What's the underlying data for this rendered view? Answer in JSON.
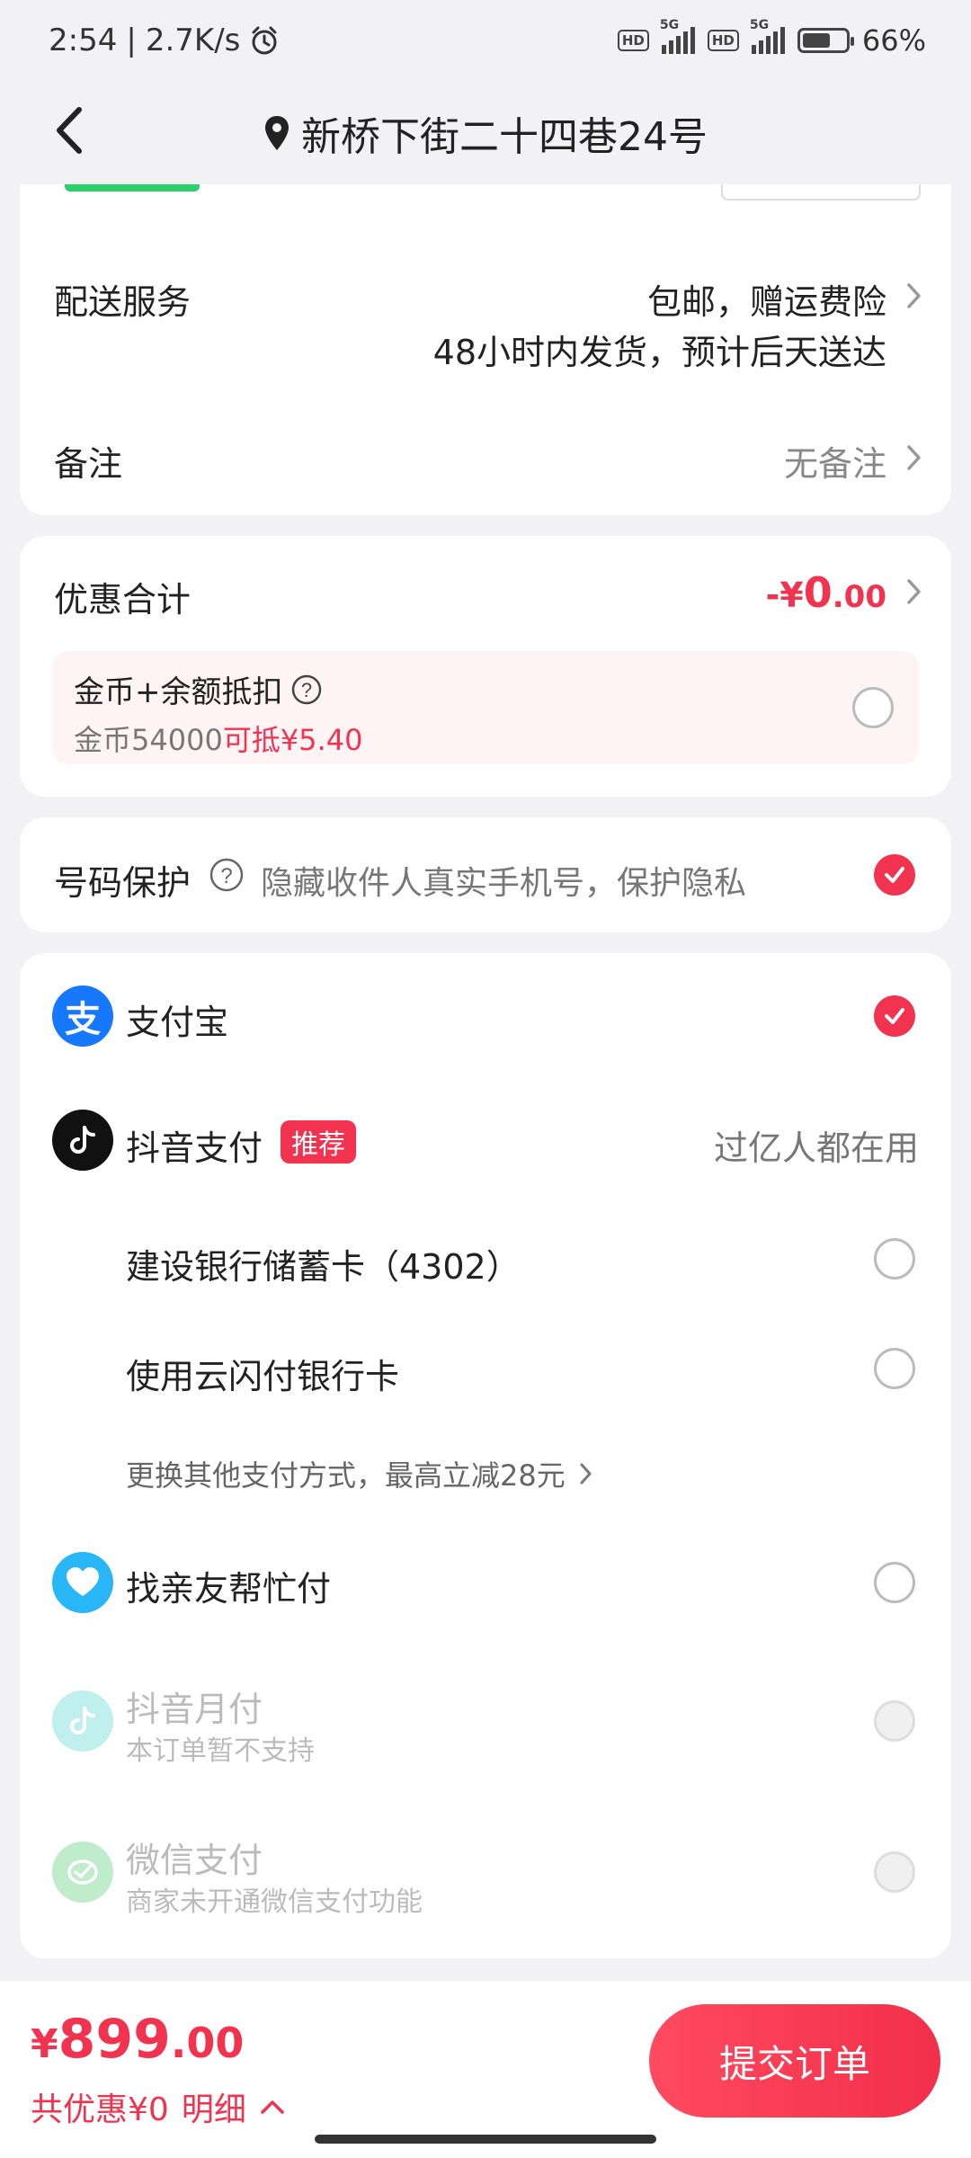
{
  "status_bar": {
    "time": "2:54",
    "net_speed": "2.7K/s",
    "battery": "66%",
    "battery_level": 0.66
  },
  "header": {
    "title": "新桥下街二十四巷24号"
  },
  "delivery": {
    "label": "配送服务",
    "value_line1": "包邮，赠运费险",
    "value_line2": "48小时内发货，预计后天送达"
  },
  "remark": {
    "label": "备注",
    "value": "无备注"
  },
  "discount": {
    "label": "优惠合计",
    "value_prefix": "-¥",
    "value_int": "0",
    "value_dec": ".00",
    "coin_title": "金币+余额抵扣",
    "coin_desc": "金币54000",
    "coin_deduct": "可抵¥5.40"
  },
  "privacy": {
    "label": "号码保护",
    "desc": "隐藏收件人真实手机号，保护隐私"
  },
  "payment": {
    "alipay": "支付宝",
    "douyin": "抖音支付",
    "douyin_badge": "推荐",
    "douyin_note": "过亿人都在用",
    "ccb_card": "建设银行储蓄卡（4302）",
    "unionpay": "使用云闪付银行卡",
    "more": "更换其他支付方式，最高立减28元",
    "friend": "找亲友帮忙付",
    "monthly": "抖音月付",
    "monthly_note": "本订单暂不支持",
    "wechat": "微信支付",
    "wechat_note": "商家未开通微信支付功能"
  },
  "footer": {
    "price_symbol": "¥",
    "price_int": "899",
    "price_dec": ".00",
    "saving": "共优惠¥0",
    "detail": "明细",
    "submit": "提交订单"
  },
  "colors": {
    "accent": "#f2334f",
    "background": "#f2f2f5",
    "alipay_blue": "#1677ff"
  }
}
